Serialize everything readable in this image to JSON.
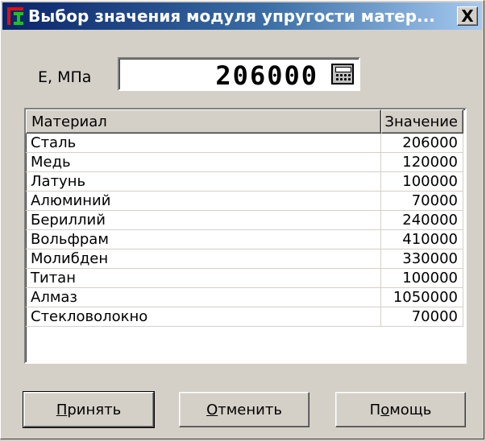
{
  "window": {
    "title": "Выбор значения модуля упругости матер...",
    "close_label": "X"
  },
  "modulus": {
    "label": "E, МПа",
    "value": "206000"
  },
  "table": {
    "headers": {
      "material": "Материал",
      "value": "Значение"
    },
    "rows": [
      {
        "material": "Сталь",
        "value": "206000"
      },
      {
        "material": "Медь",
        "value": "120000"
      },
      {
        "material": "Латунь",
        "value": "100000"
      },
      {
        "material": "Алюминий",
        "value": "70000"
      },
      {
        "material": "Бериллий",
        "value": "240000"
      },
      {
        "material": "Вольфрам",
        "value": "410000"
      },
      {
        "material": "Молибден",
        "value": "330000"
      },
      {
        "material": "Титан",
        "value": "100000"
      },
      {
        "material": "Алмаз",
        "value": "1050000"
      },
      {
        "material": "Стекловолокно",
        "value": "70000"
      }
    ]
  },
  "buttons": {
    "accept_first": "П",
    "accept_rest": "ринять",
    "cancel_first": "О",
    "cancel_rest": "тменить",
    "help_first": "П",
    "help_u": "о",
    "help_rest": "мощь"
  },
  "icons": {
    "app": "beam-app-icon",
    "calculator": "calculator-icon",
    "close": "close-icon"
  }
}
